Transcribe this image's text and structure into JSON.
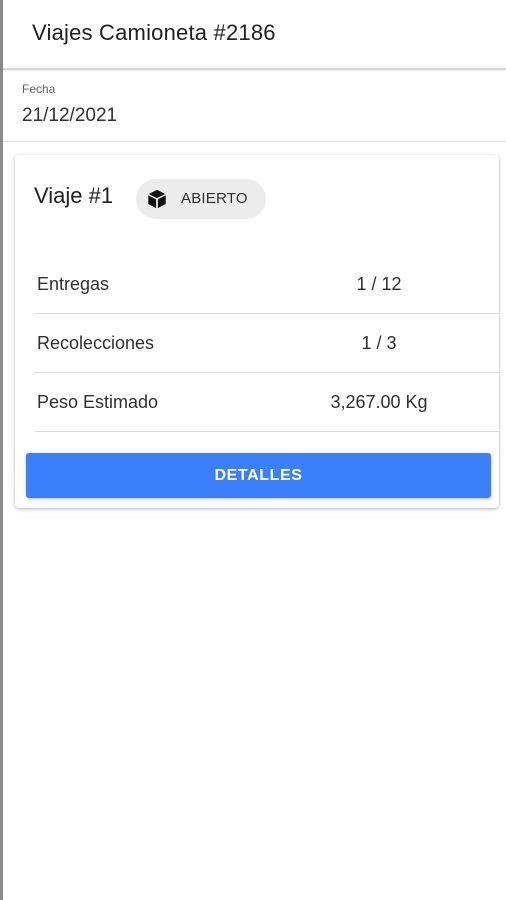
{
  "app_bar": {
    "title": "Viajes Camioneta #2186"
  },
  "date_field": {
    "label": "Fecha",
    "value": "21/12/2021"
  },
  "trip_card": {
    "title": "Viaje #1",
    "status_chip": {
      "icon": "box-icon",
      "label": "ABIERTO"
    },
    "rows": [
      {
        "label": "Entregas",
        "value": "1 / 12"
      },
      {
        "label": "Recolecciones",
        "value": "1 / 3"
      },
      {
        "label": "Peso Estimado",
        "value": "3,267.00 Kg"
      }
    ],
    "button_label": "DETALLES",
    "button_color": "#3a80fb"
  }
}
